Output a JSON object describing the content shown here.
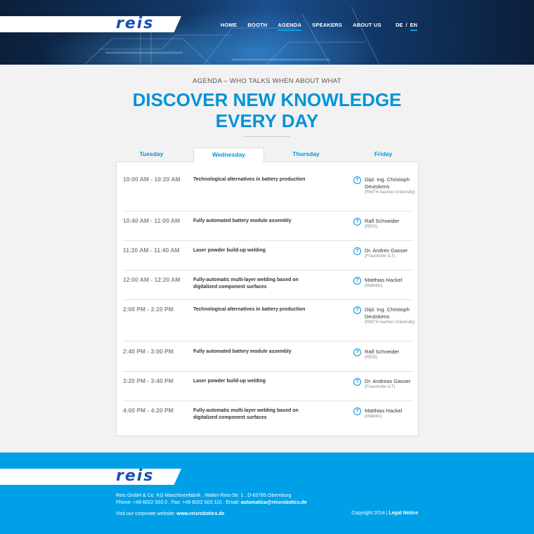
{
  "header": {
    "logo": "reis",
    "nav": [
      "HOME",
      "BOOTH",
      "AGENDA",
      "SPEAKERS",
      "ABOUT US"
    ],
    "active_nav": "AGENDA",
    "lang": {
      "de": "DE",
      "sep": "/",
      "en": "EN"
    }
  },
  "intro": {
    "kicker": "AGENDA – WHO TALKS WHEN ABOUT WHAT",
    "headline": "DISCOVER NEW KNOWLEDGE EVERY DAY"
  },
  "tabs": [
    "Tuesday",
    "Wednesday",
    "Thursday",
    "Friday"
  ],
  "active_tab": "Wednesday",
  "sessions": [
    {
      "time": "10:00 AM - 10:20 AM",
      "title": "Technological alternatives in battery production",
      "speaker": "Dipl. Ing. Christoph Deutskens",
      "affiliation": "(RWTH Aachen University)"
    },
    {
      "time": "10:40 AM - 11:00 AM",
      "title": "Fully automated battery module assembly",
      "speaker": "Ralf Schneider",
      "affiliation": "(REIS)"
    },
    {
      "time": "11:20 AM - 11:40 AM",
      "title": "Laser powder build-up welding",
      "speaker": "Dr. Andres Gasser",
      "affiliation": "(Fraunhofer ILT)"
    },
    {
      "time": "12:00 AM - 12:20 AM",
      "title": "Fully-automatic multi-layer welding based on digitalized component surfaces",
      "speaker": "Matthias Hackel",
      "affiliation": "(Mabotic)"
    },
    {
      "time": "2:00 PM - 2:20 PM",
      "title": "Technological alternatives in battery production",
      "speaker": "Dipl. Ing. Christoph Deutskens",
      "affiliation": "(RWTH Aachen University)"
    },
    {
      "time": "2:40 PM - 3:00 PM",
      "title": "Fully automated battery module assembly",
      "speaker": "Ralf Schneider",
      "affiliation": "(REIS)"
    },
    {
      "time": "3:20 PM - 3:40 PM",
      "title": "Laser powder build-up welding",
      "speaker": "Dr. Andreas Gasser",
      "affiliation": "(Fraunhofer ILT)"
    },
    {
      "time": "4:00 PM - 4:20 PM",
      "title": "Fully-automatic multi-layer welding based on digitalized component surfaces",
      "speaker": "Matthias Hackel",
      "affiliation": "(Mabotic)"
    }
  ],
  "info_icon": "?",
  "footer": {
    "logo": "reis",
    "address": "Reis GmbH & Co. KG Maschinenfabrik . Walter-Reis-Str. 1 . D-63785 Obernburg",
    "phone_line": "Phone: +49 6022 503 0 . Fax: +49 6022 503 110 . Email: ",
    "email": "automatica@reisrobotics.de",
    "corporate_label": "Visit our corporate website: ",
    "corporate_url": "www.reisrobotics.de",
    "copyright": "Copyright 2014 | ",
    "legal": "Legal Notice"
  },
  "colors": {
    "accent": "#0094d8",
    "footer_bg": "#00a0e8",
    "header_bg": "#0d2545"
  }
}
